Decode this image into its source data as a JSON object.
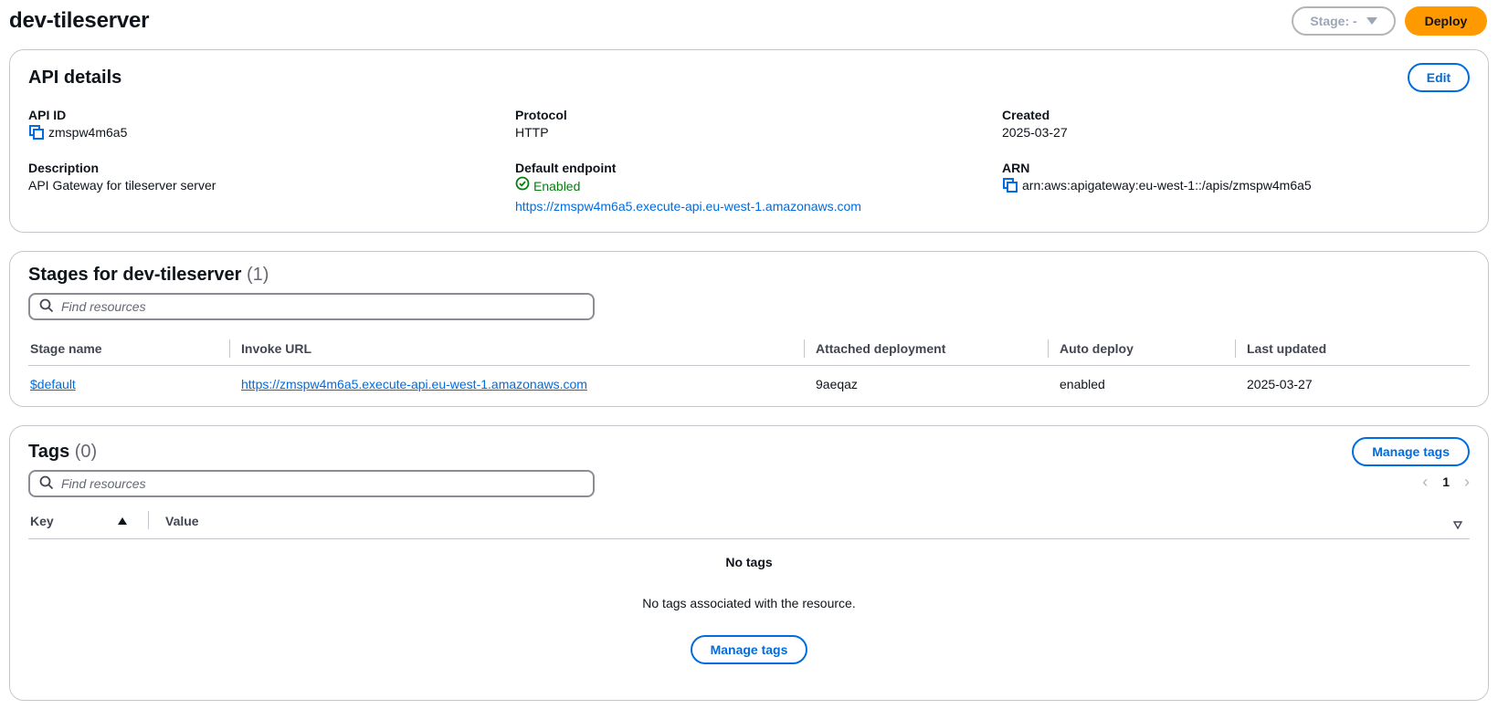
{
  "header": {
    "title": "dev-tileserver",
    "stage_select": "Stage: -",
    "deploy_label": "Deploy"
  },
  "api_details": {
    "heading": "API details",
    "edit_label": "Edit",
    "api_id_label": "API ID",
    "api_id": "zmspw4m6a5",
    "protocol_label": "Protocol",
    "protocol": "HTTP",
    "created_label": "Created",
    "created": "2025-03-27",
    "description_label": "Description",
    "description": "API Gateway for tileserver server",
    "default_endpoint_label": "Default endpoint",
    "default_endpoint_status": "Enabled",
    "default_endpoint_url": "https://zmspw4m6a5.execute-api.eu-west-1.amazonaws.com",
    "arn_label": "ARN",
    "arn": "arn:aws:apigateway:eu-west-1::/apis/zmspw4m6a5"
  },
  "stages": {
    "heading": "Stages for dev-tileserver",
    "count": "(1)",
    "search_placeholder": "Find resources",
    "columns": [
      "Stage name",
      "Invoke URL",
      "Attached deployment",
      "Auto deploy",
      "Last updated"
    ],
    "rows": [
      {
        "stage_name": "$default",
        "invoke_url": "https://zmspw4m6a5.execute-api.eu-west-1.amazonaws.com",
        "attached_deployment": "9aeqaz",
        "auto_deploy": "enabled",
        "last_updated": "2025-03-27"
      }
    ]
  },
  "tags": {
    "heading": "Tags",
    "count": "(0)",
    "manage_label": "Manage tags",
    "search_placeholder": "Find resources",
    "page": "1",
    "columns": [
      "Key",
      "Value"
    ],
    "empty_title": "No tags",
    "empty_desc": "No tags associated with the resource.",
    "empty_button": "Manage tags"
  },
  "colors": {
    "primary": "#006ce0",
    "deploy": "#ff9900",
    "success": "#037f0c",
    "border": "#c6c6cd"
  }
}
